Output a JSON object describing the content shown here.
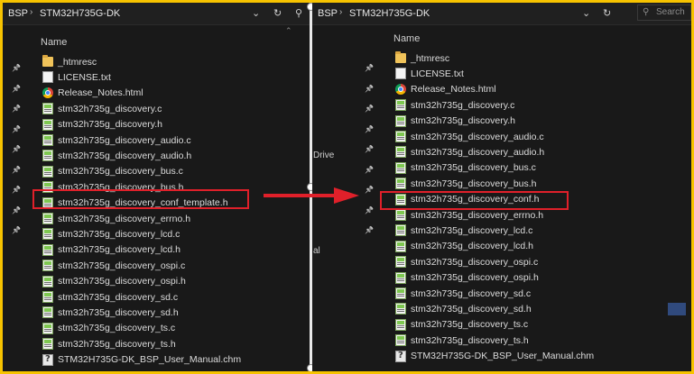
{
  "left": {
    "breadcrumb": [
      "BSP",
      "STM32H735G-DK"
    ],
    "column_header": "Name",
    "files": [
      {
        "name": "_htmresc",
        "icon": "folder-icon"
      },
      {
        "name": "LICENSE.txt",
        "icon": "text-file-icon"
      },
      {
        "name": "Release_Notes.html",
        "icon": "chrome-icon"
      },
      {
        "name": "stm32h735g_discovery.c",
        "icon": "notepad-file-icon"
      },
      {
        "name": "stm32h735g_discovery.h",
        "icon": "notepad-file-icon"
      },
      {
        "name": "stm32h735g_discovery_audio.c",
        "icon": "notepad-file-icon"
      },
      {
        "name": "stm32h735g_discovery_audio.h",
        "icon": "notepad-file-icon"
      },
      {
        "name": "stm32h735g_discovery_bus.c",
        "icon": "notepad-file-icon"
      },
      {
        "name": "stm32h735g_discovery_bus.h",
        "icon": "notepad-file-icon"
      },
      {
        "name": "stm32h735g_discovery_conf_template.h",
        "icon": "notepad-file-icon",
        "highlighted": true
      },
      {
        "name": "stm32h735g_discovery_errno.h",
        "icon": "notepad-file-icon"
      },
      {
        "name": "stm32h735g_discovery_lcd.c",
        "icon": "notepad-file-icon"
      },
      {
        "name": "stm32h735g_discovery_lcd.h",
        "icon": "notepad-file-icon"
      },
      {
        "name": "stm32h735g_discovery_ospi.c",
        "icon": "notepad-file-icon"
      },
      {
        "name": "stm32h735g_discovery_ospi.h",
        "icon": "notepad-file-icon"
      },
      {
        "name": "stm32h735g_discovery_sd.c",
        "icon": "notepad-file-icon"
      },
      {
        "name": "stm32h735g_discovery_sd.h",
        "icon": "notepad-file-icon"
      },
      {
        "name": "stm32h735g_discovery_ts.c",
        "icon": "notepad-file-icon"
      },
      {
        "name": "stm32h735g_discovery_ts.h",
        "icon": "notepad-file-icon"
      },
      {
        "name": "STM32H735G-DK_BSP_User_Manual.chm",
        "icon": "chm-help-file-icon"
      }
    ]
  },
  "right": {
    "breadcrumb": [
      "BSP",
      "STM32H735G-DK"
    ],
    "search_placeholder": "Search",
    "column_header": "Name",
    "nav_fragments": [
      "Drive",
      "al"
    ],
    "files": [
      {
        "name": "_htmresc",
        "icon": "folder-icon"
      },
      {
        "name": "LICENSE.txt",
        "icon": "text-file-icon"
      },
      {
        "name": "Release_Notes.html",
        "icon": "chrome-icon"
      },
      {
        "name": "stm32h735g_discovery.c",
        "icon": "notepad-file-icon"
      },
      {
        "name": "stm32h735g_discovery.h",
        "icon": "notepad-file-icon"
      },
      {
        "name": "stm32h735g_discovery_audio.c",
        "icon": "notepad-file-icon"
      },
      {
        "name": "stm32h735g_discovery_audio.h",
        "icon": "notepad-file-icon"
      },
      {
        "name": "stm32h735g_discovery_bus.c",
        "icon": "notepad-file-icon"
      },
      {
        "name": "stm32h735g_discovery_bus.h",
        "icon": "notepad-file-icon"
      },
      {
        "name": "stm32h735g_discovery_conf.h",
        "icon": "notepad-file-icon",
        "highlighted": true
      },
      {
        "name": "stm32h735g_discovery_errno.h",
        "icon": "notepad-file-icon"
      },
      {
        "name": "stm32h735g_discovery_lcd.c",
        "icon": "notepad-file-icon"
      },
      {
        "name": "stm32h735g_discovery_lcd.h",
        "icon": "notepad-file-icon"
      },
      {
        "name": "stm32h735g_discovery_ospi.c",
        "icon": "notepad-file-icon"
      },
      {
        "name": "stm32h735g_discovery_ospi.h",
        "icon": "notepad-file-icon"
      },
      {
        "name": "stm32h735g_discovery_sd.c",
        "icon": "notepad-file-icon"
      },
      {
        "name": "stm32h735g_discovery_sd.h",
        "icon": "notepad-file-icon"
      },
      {
        "name": "stm32h735g_discovery_ts.c",
        "icon": "notepad-file-icon"
      },
      {
        "name": "stm32h735g_discovery_ts.h",
        "icon": "notepad-file-icon"
      },
      {
        "name": "STM32H735G-DK_BSP_User_Manual.chm",
        "icon": "chm-help-file-icon"
      }
    ]
  },
  "colors": {
    "border": "#f7c300",
    "highlight": "#e0202a",
    "arrow": "#e0202a",
    "background": "#191919"
  }
}
